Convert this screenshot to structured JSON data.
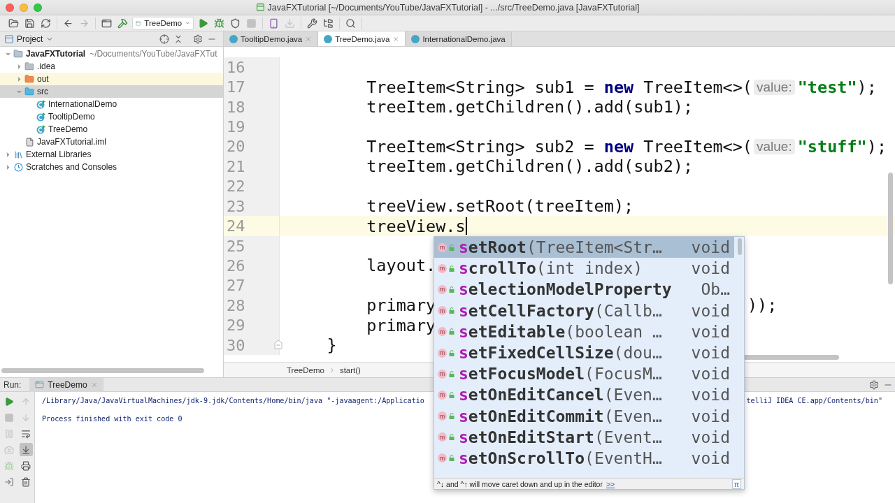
{
  "window": {
    "title": "JavaFXTutorial [~/Documents/YouTube/JavaFXTutorial] - .../src/TreeDemo.java [JavaFXTutorial]"
  },
  "toolbar": {
    "groups": [
      [
        {
          "kind": "open",
          "disabled": false
        },
        {
          "kind": "save",
          "disabled": false
        },
        {
          "kind": "sync",
          "disabled": false
        }
      ],
      [
        {
          "kind": "back",
          "disabled": false
        },
        {
          "kind": "forward",
          "disabled": true
        }
      ],
      [
        {
          "kind": "frame",
          "disabled": false
        },
        {
          "kind": "build",
          "disabled": false
        },
        {
          "kind": "config",
          "label": "TreeDemo",
          "disabled": false
        },
        {
          "kind": "run",
          "disabled": false
        },
        {
          "kind": "debug",
          "disabled": false
        },
        {
          "kind": "coverage",
          "disabled": false
        },
        {
          "kind": "stop",
          "disabled": true
        }
      ],
      [
        {
          "kind": "device",
          "disabled": false
        },
        {
          "kind": "sdk",
          "disabled": true
        }
      ],
      [
        {
          "kind": "settings",
          "disabled": false
        },
        {
          "kind": "structure",
          "disabled": false
        }
      ],
      [
        {
          "kind": "search",
          "disabled": false
        }
      ]
    ]
  },
  "project_panel": {
    "title": "Project",
    "tree": [
      {
        "label": "JavaFXTutorial",
        "path": "~/Documents/YouTube/JavaFXTut",
        "kind": "module",
        "expanded": true,
        "selected": false,
        "highlighted": false,
        "children": [
          {
            "label": ".idea",
            "kind": "folder",
            "expanded": false,
            "selected": false,
            "highlighted": false
          },
          {
            "label": "out",
            "kind": "excluded",
            "expanded": false,
            "selected": false,
            "highlighted": true
          },
          {
            "label": "src",
            "kind": "source",
            "expanded": true,
            "selected": true,
            "highlighted": false,
            "children": [
              {
                "label": "InternationalDemo",
                "kind": "class",
                "selected": false,
                "highlighted": false
              },
              {
                "label": "TooltipDemo",
                "kind": "class",
                "selected": false,
                "highlighted": false
              },
              {
                "label": "TreeDemo",
                "kind": "class",
                "selected": false,
                "highlighted": false
              }
            ]
          },
          {
            "label": "JavaFXTutorial.iml",
            "kind": "file",
            "selected": false,
            "highlighted": false
          }
        ]
      },
      {
        "label": "External Libraries",
        "kind": "libraries",
        "expanded": false,
        "selected": false,
        "highlighted": false
      },
      {
        "label": "Scratches and Consoles",
        "kind": "scratches",
        "expanded": false,
        "selected": false,
        "highlighted": false
      }
    ]
  },
  "editor": {
    "tabs": [
      {
        "label": "TooltipDemo.java",
        "selected": false,
        "closable": true
      },
      {
        "label": "TreeDemo.java",
        "selected": true,
        "closable": true
      },
      {
        "label": "InternationalDemo.java",
        "selected": false,
        "closable": false
      }
    ],
    "lines": [
      {
        "number": "16",
        "current": false,
        "caret": false,
        "fold": false
      },
      {
        "number": "17",
        "current": false,
        "caret": false,
        "fold": false,
        "tokens": [
          {
            "kind": "code",
            "text": "        TreeItem<String> sub1 = "
          },
          {
            "kind": "keyword",
            "text": "new"
          },
          {
            "kind": "code",
            "text": " TreeItem<>("
          },
          {
            "kind": "hint",
            "text": "value:"
          },
          {
            "kind": "string",
            "text": "\"test\""
          },
          {
            "kind": "code",
            "text": ");"
          }
        ]
      },
      {
        "number": "18",
        "current": false,
        "caret": false,
        "fold": false,
        "tokens": [
          {
            "kind": "code",
            "text": "        treeItem.getChildren().add(sub1);"
          }
        ]
      },
      {
        "number": "19",
        "current": false,
        "caret": false,
        "fold": false
      },
      {
        "number": "20",
        "current": false,
        "caret": false,
        "fold": false,
        "tokens": [
          {
            "kind": "code",
            "text": "        TreeItem<String> sub2 = "
          },
          {
            "kind": "keyword",
            "text": "new"
          },
          {
            "kind": "code",
            "text": " TreeItem<>("
          },
          {
            "kind": "hint",
            "text": "value:"
          },
          {
            "kind": "string",
            "text": "\"stuff\""
          },
          {
            "kind": "code",
            "text": ");"
          }
        ]
      },
      {
        "number": "21",
        "current": false,
        "caret": false,
        "fold": false,
        "tokens": [
          {
            "kind": "code",
            "text": "        treeItem.getChildren().add(sub2);"
          }
        ]
      },
      {
        "number": "22",
        "current": false,
        "caret": false,
        "fold": false
      },
      {
        "number": "23",
        "current": false,
        "caret": false,
        "fold": false,
        "tokens": [
          {
            "kind": "code",
            "text": "        treeView.setRoot(treeItem);"
          }
        ]
      },
      {
        "number": "24",
        "current": true,
        "caret": true,
        "fold": false,
        "tokens": [
          {
            "kind": "code",
            "text": "        treeView.s"
          }
        ]
      },
      {
        "number": "25",
        "current": false,
        "caret": false,
        "fold": false
      },
      {
        "number": "26",
        "current": false,
        "caret": false,
        "fold": false,
        "tokens": [
          {
            "kind": "code",
            "text": "        layout."
          }
        ]
      },
      {
        "number": "27",
        "current": false,
        "caret": false,
        "fold": false
      },
      {
        "number": "28",
        "current": false,
        "caret": false,
        "fold": false,
        "tokens": [
          {
            "kind": "code",
            "text": "        primary"
          },
          {
            "kind": "tail",
            "text": "));"
          }
        ]
      },
      {
        "number": "29",
        "current": false,
        "caret": false,
        "fold": false,
        "tokens": [
          {
            "kind": "code",
            "text": "        primary"
          }
        ]
      },
      {
        "number": "30",
        "current": false,
        "caret": false,
        "fold": true,
        "tokens": [
          {
            "kind": "code",
            "text": "    }"
          }
        ]
      }
    ],
    "breadcrumb": [
      "TreeDemo",
      "start()"
    ]
  },
  "completion": {
    "items": [
      {
        "badge": "m",
        "prefix": "s",
        "rest": "etRoot",
        "params": "(TreeItem<Str…",
        "type": "void",
        "selected": true
      },
      {
        "badge": "m",
        "prefix": "s",
        "rest": "crollTo",
        "params": "(int index)",
        "type": "void",
        "selected": false
      },
      {
        "badge": "m",
        "prefix": "s",
        "rest": "electionModelProperty",
        "type": "Ob…",
        "selected": false
      },
      {
        "badge": "m",
        "prefix": "s",
        "rest": "etCellFactory",
        "params": "(Callb…",
        "type": "void",
        "selected": false
      },
      {
        "badge": "m",
        "prefix": "s",
        "rest": "etEditable",
        "params": "(boolean …",
        "type": "void",
        "selected": false
      },
      {
        "badge": "m",
        "prefix": "s",
        "rest": "etFixedCellSize",
        "params": "(dou…",
        "type": "void",
        "selected": false
      },
      {
        "badge": "m",
        "prefix": "s",
        "rest": "etFocusModel",
        "params": "(FocusM…",
        "type": "void",
        "selected": false
      },
      {
        "badge": "m",
        "prefix": "s",
        "rest": "etOnEditCancel",
        "params": "(Even…",
        "type": "void",
        "selected": false
      },
      {
        "badge": "m",
        "prefix": "s",
        "rest": "etOnEditCommit",
        "params": "(Even…",
        "type": "void",
        "selected": false
      },
      {
        "badge": "m",
        "prefix": "s",
        "rest": "etOnEditStart",
        "params": "(Event…",
        "type": "void",
        "selected": false
      },
      {
        "badge": "m",
        "prefix": "s",
        "rest": "etOnScrollTo",
        "params": "(EventH…",
        "type": "void",
        "selected": false
      }
    ],
    "footer": "^↓ and ^↑ will move caret down and up in the editor",
    "link": ">>",
    "corner": "π"
  },
  "run_panel": {
    "label": "Run:",
    "tab": "TreeDemo",
    "left_tools": [
      {
        "kind": "rerun",
        "disabled": false
      },
      {
        "kind": "stop",
        "disabled": true
      },
      {
        "kind": "pause",
        "disabled": true
      },
      {
        "kind": "camera",
        "disabled": true
      },
      {
        "kind": "debug",
        "disabled": true
      },
      {
        "kind": "exit",
        "disabled": false
      }
    ],
    "right_tools": [
      {
        "kind": "up",
        "disabled": true,
        "on": false
      },
      {
        "kind": "down",
        "disabled": true,
        "on": false
      },
      {
        "kind": "wrap",
        "disabled": false,
        "on": false
      },
      {
        "kind": "scroll",
        "disabled": false,
        "on": true
      },
      {
        "kind": "print",
        "disabled": false,
        "on": false
      },
      {
        "kind": "trash",
        "disabled": false,
        "on": false
      }
    ],
    "console": [
      {
        "text": "/Library/Java/JavaVirtualMachines/jdk-9.jdk/Contents/Home/bin/java \"-javaagent:/Applicatio",
        "tail": "telliJ IDEA CE.app/Contents/bin\""
      },
      {
        "text": "Process finished with exit code 0"
      }
    ]
  }
}
